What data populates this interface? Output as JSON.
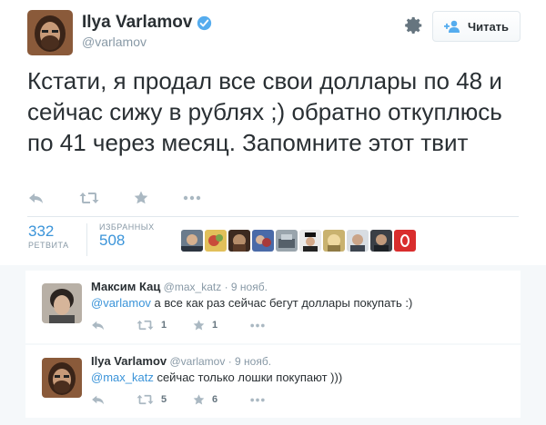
{
  "tweet": {
    "author_name": "Ilya Varlamov",
    "author_handle": "@varlamov",
    "follow_label": "Читать",
    "text": "Кстати, я продал все свои доллары по 48 и сейчас сижу в рублях ;) обратно откуплюсь по 41 через месяц. Запомните этот твит",
    "retweets_count": "332",
    "retweets_label": "РЕТВИТА",
    "favorites_count": "508",
    "favorites_label": "ИЗБРАННЫХ",
    "favoriter_avatar_count": 10
  },
  "replies": [
    {
      "name": "Максим Кац",
      "handle": "@max_katz",
      "time": "9 нояб.",
      "mention": "@varlamov",
      "text": " а все как раз сейчас бегут доллары покупать :)",
      "retweets": "1",
      "favorites": "1"
    },
    {
      "name": "Ilya Varlamov",
      "handle": "@varlamov",
      "time": "9 нояб.",
      "mention": "@max_katz",
      "text": " сейчас только лошки покупают )))",
      "retweets": "5",
      "favorites": "6"
    }
  ],
  "colors": {
    "link": "#3b94d9",
    "text": "#292f33",
    "muted": "#8899a6",
    "icon": "#aab8c2",
    "verified": "#55acee",
    "reply_area_bg": "#f5f8fa"
  },
  "icons": {
    "reply": "reply-arrow-icon",
    "retweet": "retweet-icon",
    "favorite": "star-icon",
    "more": "more-dots-icon",
    "settings": "gear-icon",
    "follow": "add-user-icon",
    "verified": "verified-badge-icon"
  }
}
